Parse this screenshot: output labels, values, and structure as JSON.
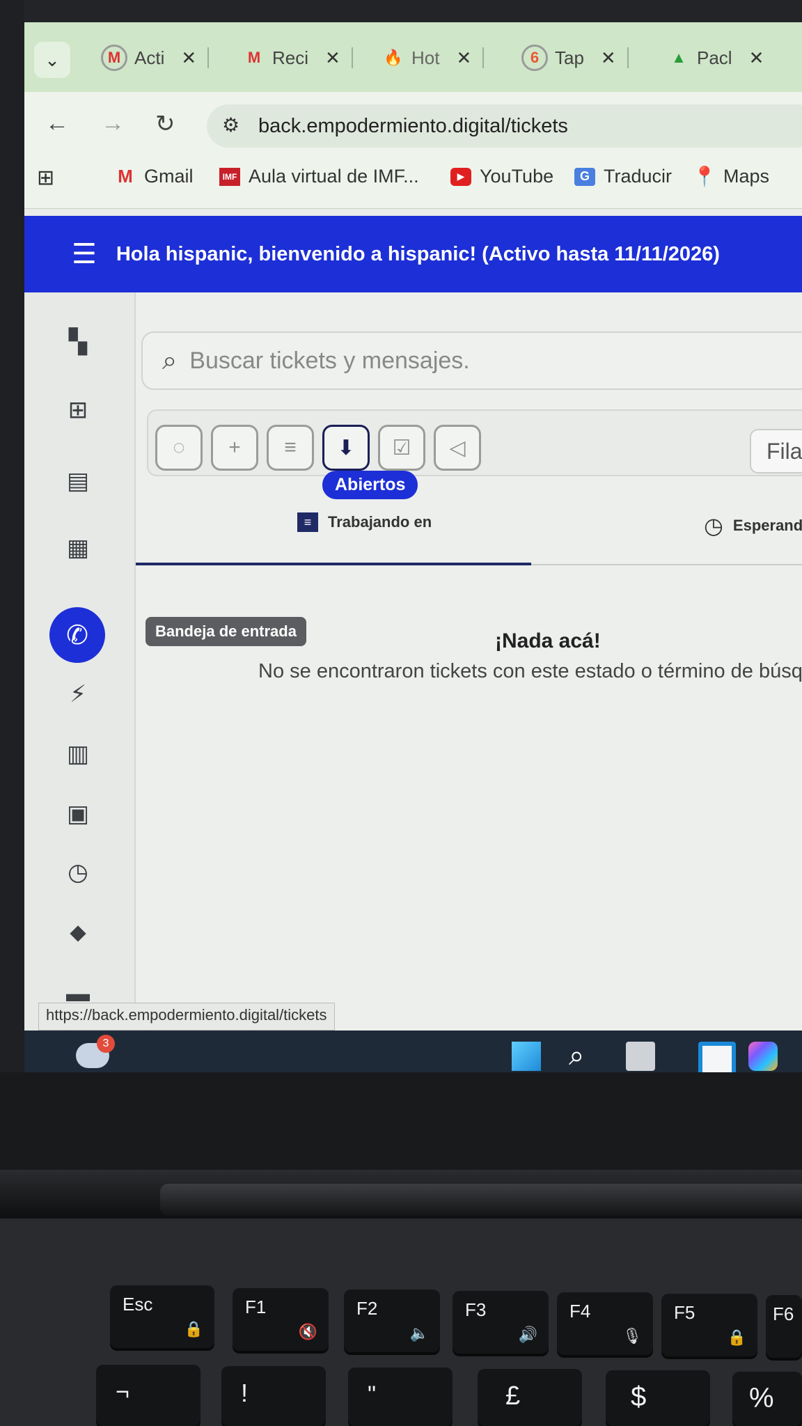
{
  "browser": {
    "tabs": [
      {
        "label": "Acti",
        "icon": "gmail-account-icon"
      },
      {
        "label": "Reci",
        "icon": "gmail-icon"
      },
      {
        "label": "Hot",
        "icon": "hotmart-icon"
      },
      {
        "label": "Tap",
        "icon": "tappy-icon"
      },
      {
        "label": "Pacl",
        "icon": "drive-icon"
      }
    ],
    "url": "back.empodermiento.digital/tickets",
    "bookmarks": [
      {
        "label": "Gmail",
        "icon": "gmail-icon"
      },
      {
        "label": "Aula virtual de IMF...",
        "icon": "imf-icon",
        "badge": "IMF"
      },
      {
        "label": "YouTube",
        "icon": "youtube-icon"
      },
      {
        "label": "Traducir",
        "icon": "translate-icon"
      },
      {
        "label": "Maps",
        "icon": "maps-icon"
      }
    ],
    "status_url": "https://back.empodermiento.digital/tickets"
  },
  "app": {
    "header_title": "Hola hispanic, bienvenido a hispanic! (Activo hasta 11/11/2026)",
    "search_placeholder": "Buscar tickets y mensajes.",
    "queue_label": "Fila",
    "tooltip_open": "Abiertos",
    "subtabs": [
      {
        "label": "Trabajando en",
        "icon": "chat-icon"
      },
      {
        "label": "Esperando",
        "icon": "clock-icon"
      }
    ],
    "inbox_chip": "Bandeja de entrada",
    "empty_title": "¡Nada acá!",
    "empty_message": "No se encontraron tickets con este estado o término de búsque"
  },
  "taskbar": {
    "weather_badge": "3"
  },
  "keyboard": {
    "keys": [
      {
        "label": "Esc",
        "sub": "fn-lock"
      },
      {
        "label": "F1",
        "sub": "mute"
      },
      {
        "label": "F2",
        "sub": "vol-down"
      },
      {
        "label": "F3",
        "sub": "vol-up"
      },
      {
        "label": "F4",
        "sub": "mic-mute"
      },
      {
        "label": "F5",
        "sub": "lock"
      },
      {
        "label": "F6",
        "sub": ""
      }
    ],
    "row2": [
      "¬",
      "!",
      "\"",
      "£",
      "$",
      "%"
    ]
  },
  "colors": {
    "brand": "#1d2fd6",
    "tabstrip": "#cfe6c8",
    "active_tab_line": "#1f2a66"
  }
}
